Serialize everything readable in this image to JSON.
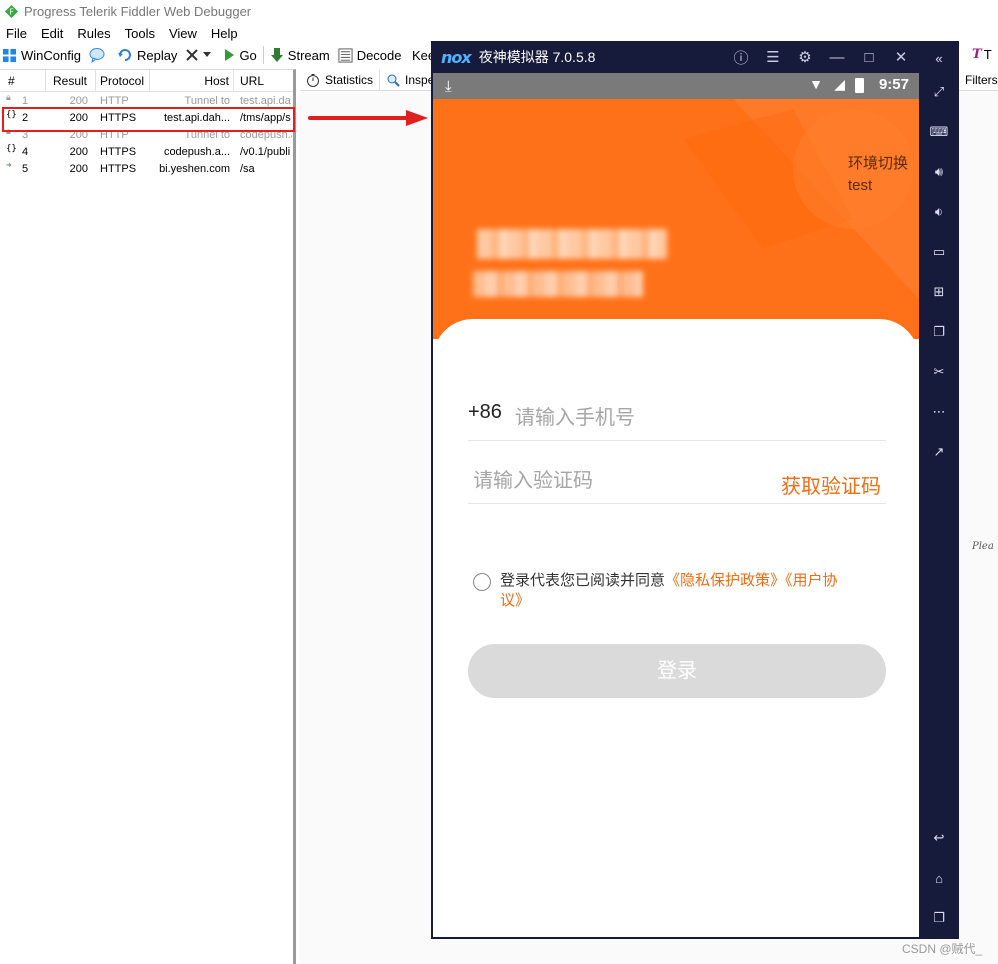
{
  "fiddler": {
    "title": "Progress Telerik Fiddler Web Debugger",
    "menu": [
      "File",
      "Edit",
      "Rules",
      "Tools",
      "View",
      "Help"
    ],
    "toolbar": {
      "winconfig": "WinConfig",
      "replay": "Replay",
      "go": "Go",
      "stream": "Stream",
      "decode": "Decode",
      "keep": "Kee",
      "textwizard": "T"
    },
    "columns": [
      "#",
      "Result",
      "Protocol",
      "Host",
      "URL"
    ],
    "sessions": [
      {
        "num": "1",
        "result": "200",
        "protocol": "HTTP",
        "host": "Tunnel to",
        "url": "test.api.da",
        "icon": "lock-icon",
        "dim": true
      },
      {
        "num": "2",
        "result": "200",
        "protocol": "HTTPS",
        "host": "test.api.dah...",
        "url": "/tms/app/s",
        "icon": "json-icon",
        "dim": false
      },
      {
        "num": "3",
        "result": "200",
        "protocol": "HTTP",
        "host": "Tunnel to",
        "url": "codepush.a",
        "icon": "lock-icon",
        "dim": true
      },
      {
        "num": "4",
        "result": "200",
        "protocol": "HTTPS",
        "host": "codepush.a...",
        "url": "/v0.1/publi",
        "icon": "json-icon",
        "dim": false
      },
      {
        "num": "5",
        "result": "200",
        "protocol": "HTTPS",
        "host": "bi.yeshen.com",
        "url": "/sa",
        "icon": "arrow-right-icon",
        "dim": false
      }
    ],
    "tabs": {
      "statistics": "Statistics",
      "inspectors": "Inspe",
      "filters": "Filters"
    },
    "right_hint": "Plea"
  },
  "nox": {
    "logo": "nox",
    "title": "夜神模拟器 7.0.5.8",
    "status_time": "9:57",
    "env_switch": "环境切换",
    "env_name": "test",
    "country_code": "+86",
    "phone_placeholder": "请输入手机号",
    "code_placeholder": "请输入验证码",
    "get_code": "获取验证码",
    "agree_prefix": "登录代表您已阅读并同意",
    "privacy_link": "《隐私保护政策》",
    "user_link_a": "《用户协",
    "user_link_b": "议》",
    "login": "登录"
  },
  "watermark": "CSDN @贼代_",
  "colors": {
    "accent": "#ff7118",
    "link": "#ef6d15",
    "nox_bg": "#161a3b",
    "selection_box": "#e02020"
  }
}
